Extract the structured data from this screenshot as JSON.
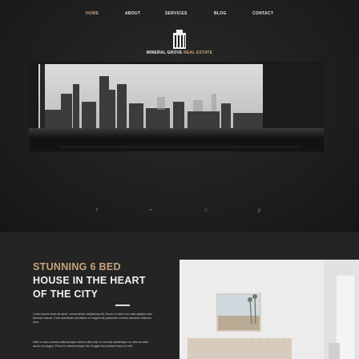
{
  "nav": {
    "home": "HOME",
    "about": "ABOUT",
    "services": "SERVICES",
    "blog": "BLOG",
    "contact": "CONTACT"
  },
  "brand": {
    "name_white": "MINERAL GROVE",
    "name_gold": "REAL ESTATE"
  },
  "social": {
    "facebook": "f",
    "twitter": "•",
    "instagram": "□",
    "pinterest": "p"
  },
  "feature": {
    "title_gold_1": "STUNNING 6 BED",
    "title_white_1": "HOUSE IN THE HEART",
    "title_white_2": "OF THE CITY",
    "paragraph_1": "Lorem ipsum dolor sit amet, consectetuer adipiscing elit. Donec id dolor non odio dapibus dict. Aenean mauris. Cras sollicitudin penatibus et magnis dis parturient montes nascetur ridiculus mus.",
    "paragraph_2": "Diam in arcu cursus euismod quis viverra nibh cras. In nisl nisi scelerisque eu ultrices vitae auctor eu augue. Purus in massa tempor nec feugiat nisl pretium fusce id velit."
  },
  "colors": {
    "accent": "#c9a47b",
    "background": "#1f1f1f",
    "section": "#242424"
  },
  "icons": [
    "building-logo-icon",
    "facebook-icon",
    "twitter-icon",
    "instagram-icon",
    "pinterest-icon"
  ]
}
